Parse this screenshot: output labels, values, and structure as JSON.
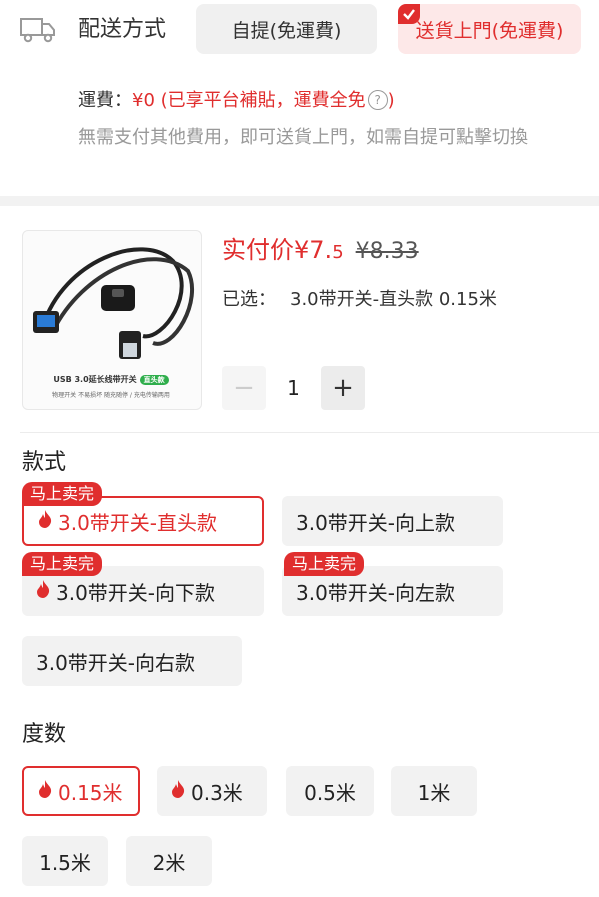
{
  "delivery": {
    "title": "配送方式",
    "options": [
      {
        "label": "自提(免運費)",
        "selected": false
      },
      {
        "label": "送貨上門(免運費)",
        "selected": true
      }
    ],
    "fee_label": "運費：",
    "fee_value": "¥0 (已享平台補貼，運費全免",
    "fee_note": "無需支付其他費用，即可送貨上門，如需自提可點擊切換"
  },
  "product": {
    "image_caption": "USB 3.0延长线带开关",
    "image_tag": "直头款",
    "image_sub": "物理开关 不易损坏 随充随停 / 充电传输两用",
    "price_label": "实付价",
    "price_symbol": "¥",
    "price_int": "7.",
    "price_dec": "5",
    "price_original": "¥8.33",
    "selected_label": "已选：",
    "selected_value": "3.0带开关-直头款 0.15米",
    "quantity": "1",
    "minus_label": "−",
    "plus_label": "+"
  },
  "style_section": {
    "label": "款式",
    "sellout_tag": "马上卖完",
    "options": [
      {
        "label": "3.0带开关-直头款",
        "hot": true,
        "selected": true,
        "tag": true
      },
      {
        "label": "3.0带开关-向上款",
        "hot": false,
        "selected": false,
        "tag": false
      },
      {
        "label": "3.0带开关-向下款",
        "hot": true,
        "selected": false,
        "tag": true
      },
      {
        "label": "3.0带开关-向左款",
        "hot": false,
        "selected": false,
        "tag": true
      },
      {
        "label": "3.0带开关-向右款",
        "hot": false,
        "selected": false,
        "tag": false
      }
    ]
  },
  "length_section": {
    "label": "度数",
    "options": [
      {
        "label": "0.15米",
        "hot": true,
        "selected": true
      },
      {
        "label": "0.3米",
        "hot": true,
        "selected": false
      },
      {
        "label": "0.5米",
        "hot": false,
        "selected": false
      },
      {
        "label": "1米",
        "hot": false,
        "selected": false
      },
      {
        "label": "1.5米",
        "hot": false,
        "selected": false
      },
      {
        "label": "2米",
        "hot": false,
        "selected": false
      }
    ]
  },
  "colors": {
    "accent": "#e02e2e",
    "chip_bg": "#f2f2f2",
    "muted": "#999999"
  }
}
